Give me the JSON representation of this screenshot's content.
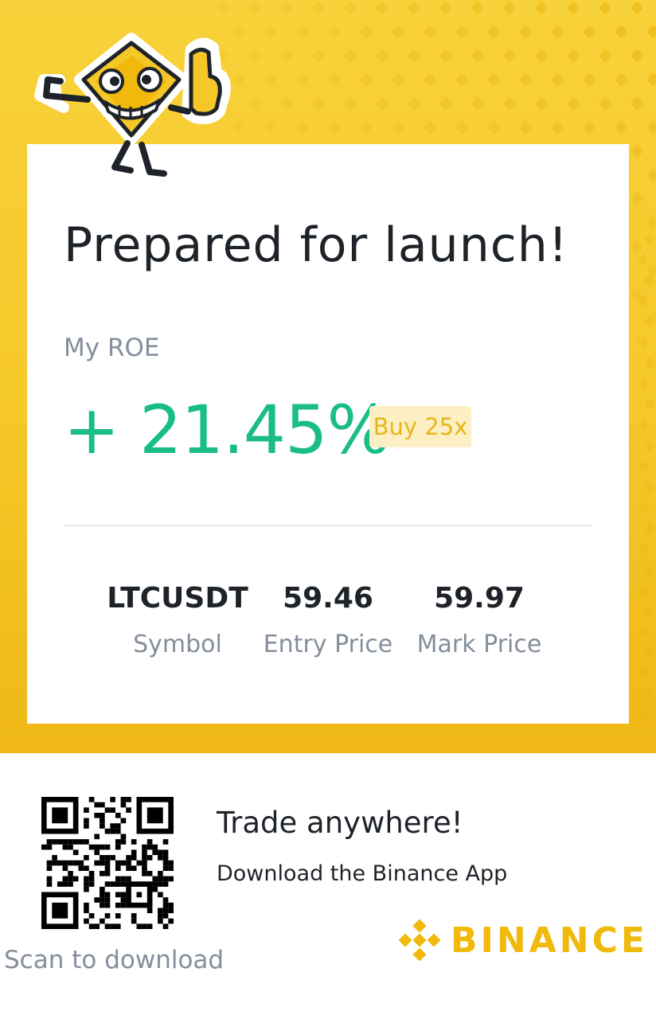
{
  "card": {
    "title": "Prepared for launch!",
    "roe_label": "My ROE",
    "roe_value": "+ 21.45%",
    "side_badge": "Buy 25x"
  },
  "stats": [
    {
      "value": "LTCUSDT",
      "label": "Symbol"
    },
    {
      "value": "59.46",
      "label": "Entry Price"
    },
    {
      "value": "59.97",
      "label": "Mark Price"
    }
  ],
  "footer": {
    "scan_label": "Scan to download",
    "cta_title": "Trade anywhere!",
    "cta_subtitle": "Download the Binance App",
    "brand_name": "BINANCE"
  },
  "icons": {
    "mascot": "mascot-coin-thumbs-up-icon",
    "qr": "qr-code-icon",
    "logo": "binance-logo-icon"
  },
  "colors": {
    "brand_yellow": "#f0b90b",
    "positive_green": "#1bbd87",
    "text_dark": "#1e2329",
    "text_muted": "#848e9c",
    "badge_bg": "#fcefc3"
  }
}
